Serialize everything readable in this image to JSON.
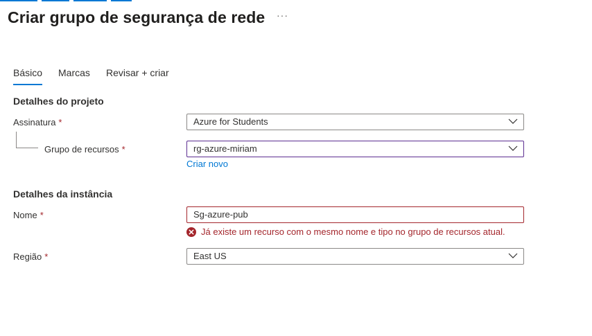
{
  "header": {
    "title": "Criar grupo de segurança de rede",
    "more_label": "···"
  },
  "tabs": [
    {
      "label": "Básico",
      "active": true
    },
    {
      "label": "Marcas",
      "active": false
    },
    {
      "label": "Revisar + criar",
      "active": false
    }
  ],
  "project": {
    "heading": "Detalhes do projeto",
    "subscription": {
      "label": "Assinatura",
      "required": "*",
      "value": "Azure for Students"
    },
    "resource_group": {
      "label": "Grupo de recursos",
      "required": "*",
      "value": "rg-azure-miriam",
      "create_new": "Criar novo"
    }
  },
  "instance": {
    "heading": "Detalhes da instância",
    "name": {
      "label": "Nome",
      "required": "*",
      "value": "Sg-azure-pub",
      "error": "Já existe um recurso com o mesmo nome e tipo no grupo de recursos atual."
    },
    "region": {
      "label": "Região",
      "required": "*",
      "value": "East US"
    }
  },
  "colors": {
    "accent": "#0078d4",
    "error": "#a4262c",
    "focus_border": "#5c2d91",
    "text": "#323130"
  }
}
